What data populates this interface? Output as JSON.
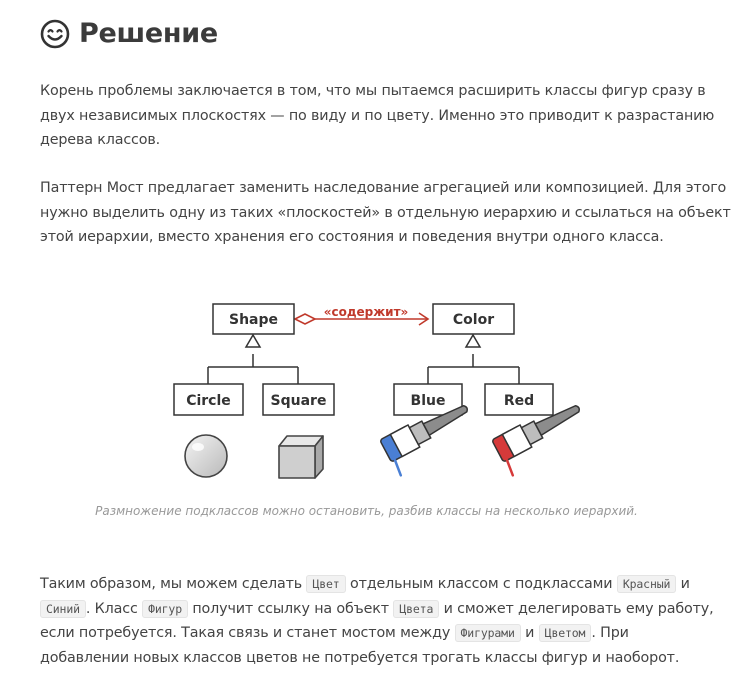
{
  "heading": {
    "title": "Решение"
  },
  "paragraph1": {
    "lines": [
      "Корень проблемы заключается в том, что мы пытаемся расширить классы фигур сразу в",
      "двух независимых плоскостях — по виду и по цвету. Именно это приводит к разрастанию",
      "дерева классов."
    ]
  },
  "paragraph2": {
    "lines": [
      "Паттерн Мост предлагает заменить наследование агрегацией или композицией. Для этого",
      "нужно выделить одну из таких «плоскостей» в отдельную иерархию и ссылаться на объект",
      "этой иерархии, вместо хранения его состояния и поведения внутри одного класса."
    ]
  },
  "diagram": {
    "relation_label": "«содержит»",
    "classes": {
      "shape": "Shape",
      "color": "Color",
      "circle": "Circle",
      "square": "Square",
      "blue": "Blue",
      "red": "Red"
    },
    "colors": {
      "relation": "#c0392b",
      "paint_blue": "#4a7fd4",
      "paint_red": "#d63a3a"
    }
  },
  "caption": "Размножение подклассов можно остановить, разбив классы на несколько иерархий.",
  "paragraph3": {
    "t1": "Таким образом, мы можем сделать ",
    "c1": "Цвет",
    "t2": " отдельным классом с подклассами ",
    "c2": "Красный",
    "t3": " и",
    "c3": "Синий",
    "t4": ". Класс ",
    "c4": "Фигур",
    "t5": " получит ссылку на объект ",
    "c5": "Цвета",
    "t6": " и сможет делегировать ему работу,",
    "t7": "если потребуется. Такая связь и станет мостом между ",
    "c6": "Фигурами",
    "t8": " и ",
    "c7": "Цветом",
    "t9": ". При",
    "t10": "добавлении новых классов цветов не потребуется трогать классы фигур и наоборот."
  }
}
